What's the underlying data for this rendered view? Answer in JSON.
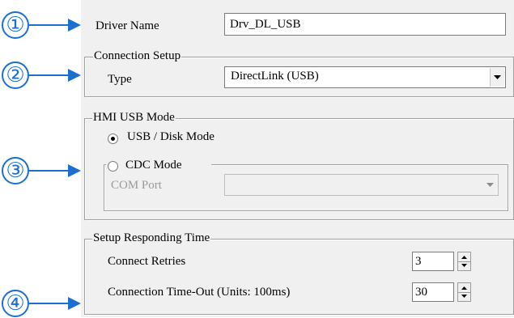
{
  "callouts": [
    "①",
    "②",
    "③",
    "④"
  ],
  "driver": {
    "label": "Driver Name",
    "value": "Drv_DL_USB"
  },
  "connection_setup": {
    "title": "Connection Setup",
    "type_label": "Type",
    "type_value": "DirectLink (USB)"
  },
  "hmi_usb_mode": {
    "title": "HMI USB Mode",
    "option_usb_disk": "USB / Disk Mode",
    "option_cdc": "CDC Mode",
    "selected": "USB / Disk Mode",
    "com_port_label": "COM Port",
    "com_port_value": ""
  },
  "responding_time": {
    "title": "Setup Responding Time",
    "retries_label": "Connect Retries",
    "retries_value": "3",
    "timeout_label": "Connection Time-Out (Units: 100ms)",
    "timeout_value": "30"
  },
  "colors": {
    "callout": "#1a6fd1",
    "panel": "#f0f0f0"
  }
}
